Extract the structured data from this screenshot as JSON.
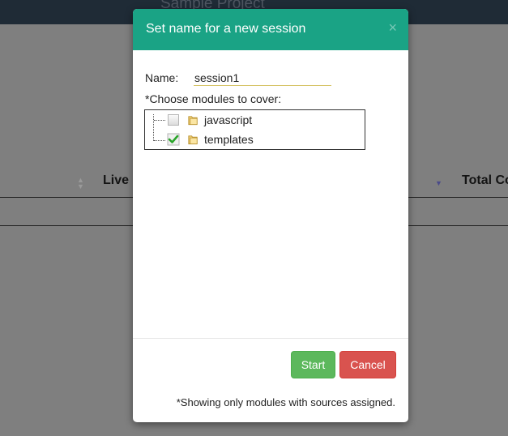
{
  "background": {
    "project_title": "Sample Project",
    "columns": [
      "Live",
      "Total Co"
    ]
  },
  "modal": {
    "title": "Set name for a new session",
    "close_glyph": "×",
    "name_label": "Name:",
    "name_value": "session1",
    "choose_label": "*Choose modules to cover:",
    "modules": [
      {
        "label": "javascript",
        "checked": false,
        "icon": "folder-icon"
      },
      {
        "label": "templates",
        "checked": true,
        "icon": "folder-icon"
      }
    ],
    "start_label": "Start",
    "cancel_label": "Cancel",
    "footer_note": "*Showing only modules with sources assigned."
  },
  "colors": {
    "header": "#1aa385",
    "start": "#5cb85c",
    "cancel": "#d9534f"
  }
}
